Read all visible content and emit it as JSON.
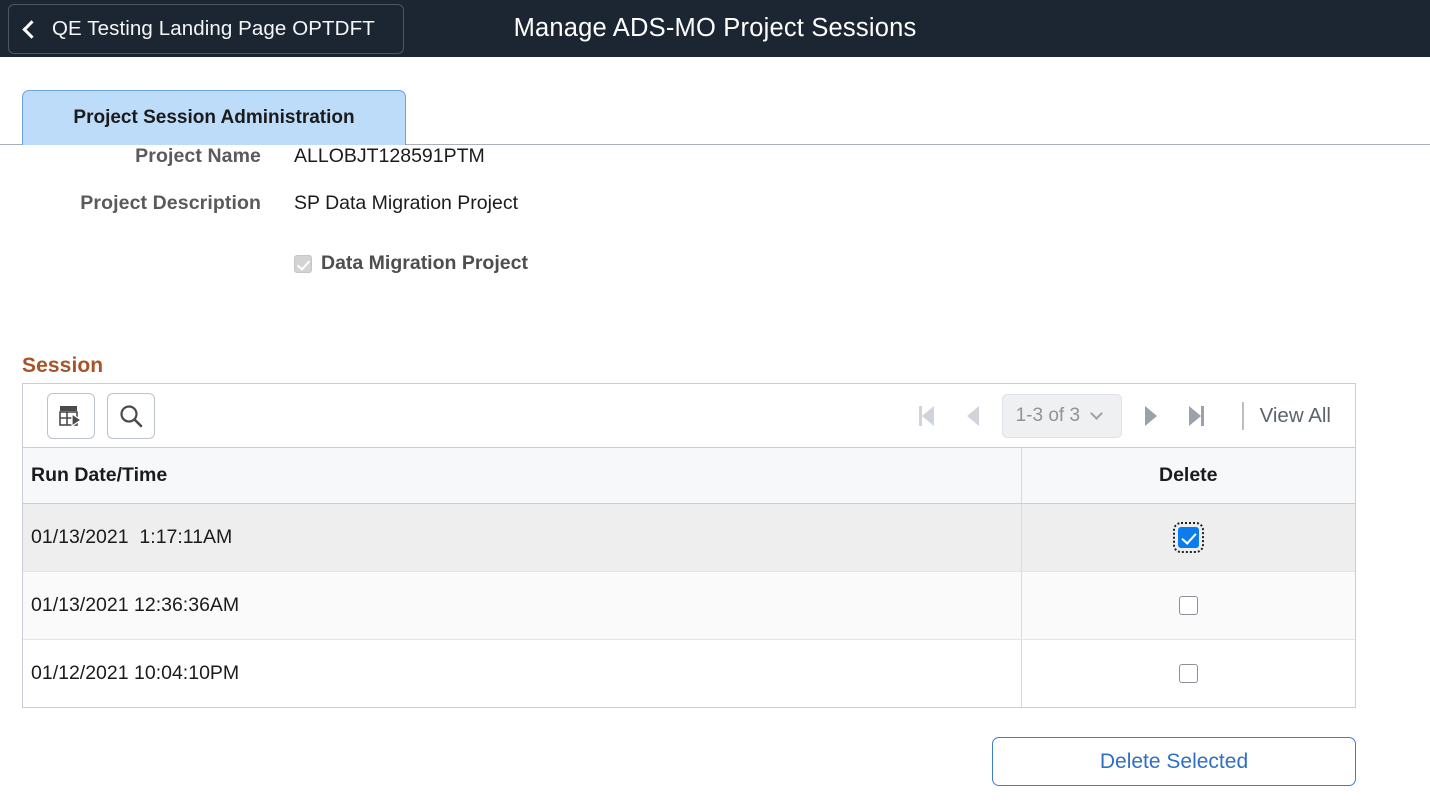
{
  "header": {
    "back_label": "QE Testing Landing Page OPTDFT",
    "back_icon": "chevron-left-icon",
    "title": "Manage ADS-MO Project Sessions",
    "bg_color": "#1c2633"
  },
  "tabs": [
    {
      "label": "Project Session Administration",
      "active": true
    }
  ],
  "form": {
    "fields": [
      {
        "label": "Project Name",
        "value": "ALLOBJT128591PTM"
      },
      {
        "label": "Project Description",
        "value": "SP Data Migration Project"
      }
    ],
    "checkbox": {
      "label": "Data Migration Project",
      "checked": true,
      "disabled": true
    }
  },
  "session": {
    "title": "Session",
    "title_color": "#a6552a",
    "toolbar": {
      "personalize_icon": "grid-personalize-icon",
      "find_icon": "search-icon"
    },
    "pager": {
      "first_icon": "first-page-icon",
      "prev_icon": "previous-page-icon",
      "range_label": "1-3 of 3",
      "range_chevron_icon": "chevron-down-icon",
      "next_icon": "next-page-icon",
      "last_icon": "last-page-icon",
      "view_all_label": "View All"
    },
    "columns": [
      {
        "key": "date",
        "label": "Run Date/Time",
        "align": "left"
      },
      {
        "key": "delete",
        "label": "Delete",
        "align": "center"
      }
    ],
    "rows": [
      {
        "date": "01/13/2021  1:17:11AM",
        "delete_checked": true,
        "state": "selected"
      },
      {
        "date": "01/13/2021 12:36:36AM",
        "delete_checked": false,
        "state": "alt"
      },
      {
        "date": "01/12/2021 10:04:10PM",
        "delete_checked": false,
        "state": "last"
      }
    ]
  },
  "actions": {
    "delete_selected_label": "Delete Selected",
    "delete_selected_color": "#2f6fc4"
  }
}
